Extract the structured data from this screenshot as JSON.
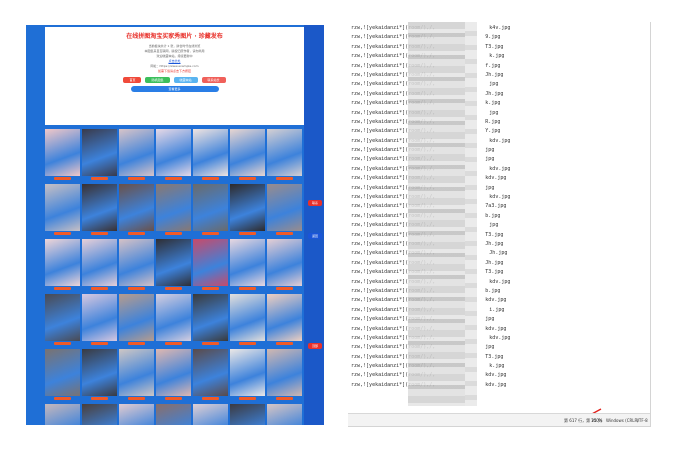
{
  "left_page": {
    "title": "在线拼图淘宝买家秀图片 · 珍藏发布",
    "info_lines": [
      "当前板块共计 1 张，拼合时代在线浏览",
      "本图集来自互联网，版权归原作者，请勿商用",
      "欢迎收藏本站，持续更新中"
    ],
    "link_text": "点击此处",
    "url_line": "网址：https://www.example.com",
    "notice": "如需下载请点击下方按钮",
    "buttons": [
      {
        "label": "首页",
        "color": "#f04a3a"
      },
      {
        "label": "随机图集",
        "color": "#3cbf5c"
      },
      {
        "label": "收藏本站",
        "color": "#5ab4f0"
      },
      {
        "label": "联系站长",
        "color": "#f0605a"
      }
    ],
    "wide_button": "查看更多",
    "thumb_caption": "查看原图",
    "side_tags": [
      {
        "label": "联系",
        "color": "#e8302a"
      },
      {
        "label": "返回",
        "color": "#1a55d8"
      },
      {
        "label": "顶部",
        "color": "#e8302a"
      }
    ],
    "thumb_colors": [
      [
        "#f2c8c8",
        "#3a3a4a",
        "#d8c4c8",
        "#e7d9e6",
        "#f0e4e0",
        "#e9d6d0",
        "#d6d0d2"
      ],
      [
        "#c8c0c4",
        "#3a3030",
        "#6a5048",
        "#8a7870",
        "#6a6a6a",
        "#2e2a2a",
        "#9a8c8c"
      ],
      [
        "#f0d6d8",
        "#e8d0d8",
        "#d6c2c6",
        "#2e2e34",
        "#c84a6a",
        "#e8d8e0",
        "#e6cfd4"
      ],
      [
        "#4a4a52",
        "#d8c8e0",
        "#b89c8c",
        "#d6cfe0",
        "#3a3a3a",
        "#e4e0dc",
        "#f0d0c0"
      ],
      [
        "#7a7270",
        "#3a3a40",
        "#cfc7c4",
        "#e0b8b0",
        "#5a4a4a",
        "#ece8e6",
        "#d2b8b0"
      ],
      [
        "#c6b8bc",
        "#4a3e3a",
        "#e2ccd0",
        "#8a6e6a",
        "#e0d0d4",
        "#3c3a40",
        "#d8c6c4"
      ]
    ]
  },
  "right_file": {
    "line_prefix": "rzw,![yekaidanzi*](room/),/,",
    "tails": [
      "k4v.jpg",
      "9.jpg",
      "T3.jpg",
      "k.jpg",
      "f.jpg",
      "Jh.jpg",
      "jpg",
      "Jh.jpg",
      "k.jpg",
      "jpg",
      "R.jpg",
      "Y.jpg",
      "kdv.jpg",
      "jpg",
      "jpg",
      "kdv.jpg",
      "kdv.jpg",
      "jpg",
      "kdv.jpg",
      "7a3.jpg",
      "b.jpg",
      "jpg",
      "T3.jpg",
      "Jh.jpg",
      "Jh.jpg",
      "Jh.jpg",
      "T3.jpg",
      "kdv.jpg",
      "b.jpg",
      "kdv.jpg",
      "i.jpg",
      "jpg",
      "kdv.jpg",
      "kdv.jpg",
      "jpg",
      "T3.jpg",
      "k.jpg",
      "kdv.jpg",
      "kdv.jpg"
    ],
    "status": {
      "position": "第 617 行，第 25 列",
      "zoom": "100%",
      "encoding": "Windows (CRLF)",
      "charset": "UTF-8"
    }
  }
}
